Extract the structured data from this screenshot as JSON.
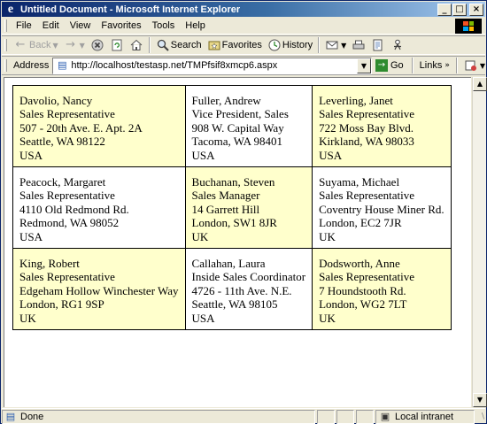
{
  "window": {
    "title": "Untitled Document - Microsoft Internet Explorer",
    "controls": {
      "minimize": "_",
      "maximize": "□",
      "close": "×"
    }
  },
  "menu": [
    "File",
    "Edit",
    "View",
    "Favorites",
    "Tools",
    "Help"
  ],
  "toolbar": {
    "back_label": "Back",
    "search_label": "Search",
    "favorites_label": "Favorites",
    "history_label": "History"
  },
  "address": {
    "label": "Address",
    "url": "http://localhost/testasp.net/TMPfsif8xmcp6.aspx",
    "go_label": "Go",
    "links_label": "Links"
  },
  "employees": [
    [
      {
        "name": "Davolio, Nancy",
        "title": "Sales Representative",
        "address": "507 - 20th Ave. E. Apt. 2A",
        "city": "Seattle, WA 98122",
        "country": "USA",
        "highlight": true
      },
      {
        "name": "Fuller, Andrew",
        "title": "Vice President, Sales",
        "address": "908 W. Capital Way",
        "city": "Tacoma, WA 98401",
        "country": "USA",
        "highlight": false
      },
      {
        "name": "Leverling, Janet",
        "title": "Sales Representative",
        "address": "722 Moss Bay Blvd.",
        "city": "Kirkland, WA 98033",
        "country": "USA",
        "highlight": true
      }
    ],
    [
      {
        "name": "Peacock, Margaret",
        "title": "Sales Representative",
        "address": "4110 Old Redmond Rd.",
        "city": "Redmond, WA 98052",
        "country": "USA",
        "highlight": false
      },
      {
        "name": "Buchanan, Steven",
        "title": "Sales Manager",
        "address": "14 Garrett Hill",
        "city": "London, SW1 8JR",
        "country": "UK",
        "highlight": true
      },
      {
        "name": "Suyama, Michael",
        "title": "Sales Representative",
        "address": "Coventry House Miner Rd.",
        "city": "London, EC2 7JR",
        "country": "UK",
        "highlight": false
      }
    ],
    [
      {
        "name": "King, Robert",
        "title": "Sales Representative",
        "address": "Edgeham Hollow Winchester Way",
        "city": "London, RG1 9SP",
        "country": "UK",
        "highlight": true
      },
      {
        "name": "Callahan, Laura",
        "title": "Inside Sales Coordinator",
        "address": "4726 - 11th Ave. N.E.",
        "city": "Seattle, WA 98105",
        "country": "USA",
        "highlight": false
      },
      {
        "name": "Dodsworth, Anne",
        "title": "Sales Representative",
        "address": "7 Houndstooth Rd.",
        "city": "London, WG2 7LT",
        "country": "UK",
        "highlight": true
      }
    ]
  ],
  "status": {
    "text": "Done",
    "zone": "Local intranet"
  },
  "colors": {
    "highlight_cell": "#ffffcc",
    "titlebar_start": "#0a246a",
    "titlebar_end": "#a6caf0"
  }
}
